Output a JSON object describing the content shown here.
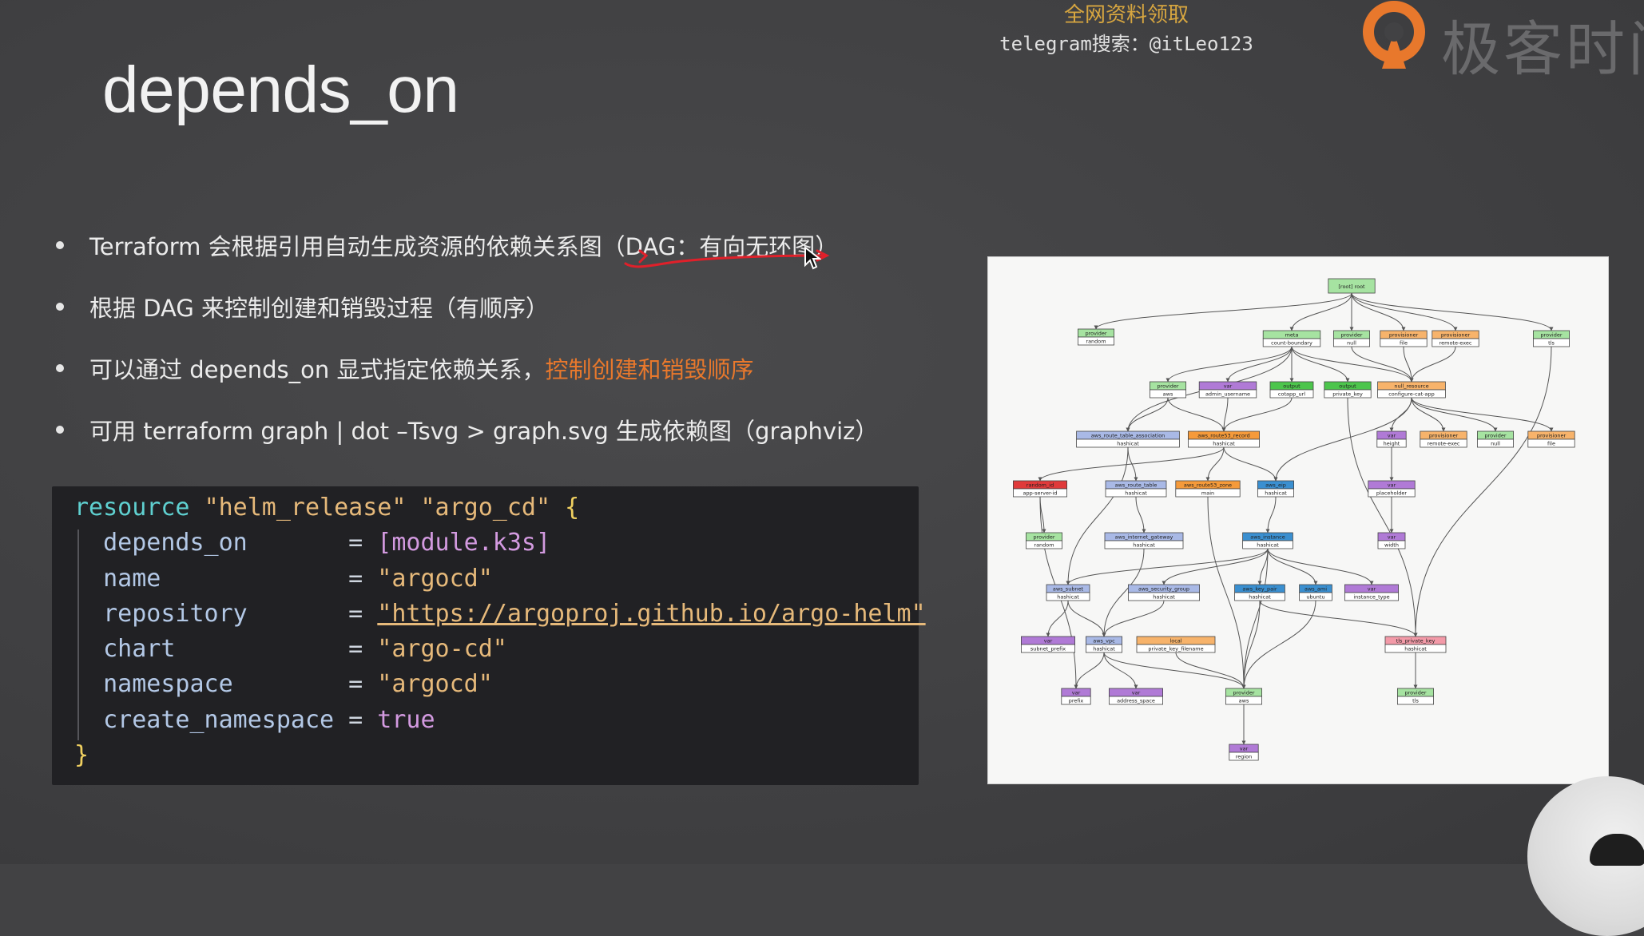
{
  "slide": {
    "title": "depends_on"
  },
  "watermark": {
    "line1": "全网资料领取",
    "line2": "telegram搜索：@itLeo123"
  },
  "brand": {
    "text": "极客时间"
  },
  "bullets": [
    {
      "before": "Terraform 会根据引用自动生成资源的依赖关系图（DAG：有向无环图）",
      "highlight": ""
    },
    {
      "before": "根据 DAG 来控制创建和销毁过程（有顺序）",
      "highlight": ""
    },
    {
      "before": "可以通过 depends_on 显式指定依赖关系，",
      "highlight": "控制创建和销毁顺序"
    },
    {
      "before": "可用 terraform graph | dot –Tsvg > graph.svg 生成依赖图（graphviz）",
      "highlight": ""
    }
  ],
  "code": {
    "resource_kw": "resource",
    "type": "\"helm_release\"",
    "name": "\"argo_cd\"",
    "open": "{",
    "close": "}",
    "eq": "=",
    "attrs": [
      {
        "key": "depends_on      ",
        "value": "[module.k3s]",
        "cls": "num"
      },
      {
        "key": "name            ",
        "value": "\"argocd\"",
        "cls": "str"
      },
      {
        "key": "repository      ",
        "value": "\"https://argoproj.github.io/argo-helm\"",
        "cls": "str"
      },
      {
        "key": "chart           ",
        "value": "\"argo-cd\"",
        "cls": "str"
      },
      {
        "key": "namespace       ",
        "value": "\"argocd\"",
        "cls": "str"
      },
      {
        "key": "create_namespace",
        "value": "true",
        "cls": "num"
      }
    ]
  },
  "graph": {
    "nodes": [
      {
        "id": "root",
        "type": "[root] root",
        "name": "",
        "color": "#a6e3a1"
      },
      {
        "id": "prov_random",
        "type": "provider",
        "name": "random",
        "color": "#a6e3a1"
      },
      {
        "id": "meta",
        "type": "meta",
        "name": "count-boundary",
        "color": "#a6e3a1"
      },
      {
        "id": "prov_null",
        "type": "provider",
        "name": "null",
        "color": "#a6e3a1"
      },
      {
        "id": "prov_file",
        "type": "provisioner",
        "name": "file",
        "color": "#f7b36b"
      },
      {
        "id": "prov_remote",
        "type": "provisioner",
        "name": "remote-exec",
        "color": "#f7b36b"
      },
      {
        "id": "prov_tls",
        "type": "provider",
        "name": "tls",
        "color": "#a6e3a1"
      },
      {
        "id": "prov_aws1",
        "type": "provider",
        "name": "aws",
        "color": "#a6e3a1"
      },
      {
        "id": "var_admin",
        "type": "var",
        "name": "admin_username",
        "color": "#b07ad6"
      },
      {
        "id": "out_cotapp",
        "type": "output",
        "name": "cotapp_url",
        "color": "#4cc54c"
      },
      {
        "id": "out_pk",
        "type": "output",
        "name": "private_key",
        "color": "#4cc54c"
      },
      {
        "id": "null_res",
        "type": "null_resource",
        "name": "configure-cat-app",
        "color": "#f7b36b"
      },
      {
        "id": "rta",
        "type": "aws_route_table_association",
        "name": "hashicat",
        "color": "#a9b9e6"
      },
      {
        "id": "r53rec",
        "type": "aws_route53_record",
        "name": "hashicat",
        "color": "#f59a3a"
      },
      {
        "id": "var_height",
        "type": "var",
        "name": "height",
        "color": "#b07ad6"
      },
      {
        "id": "prov2_remote",
        "type": "provisioner",
        "name": "remote-exec",
        "color": "#f7b36b"
      },
      {
        "id": "prov2_null",
        "type": "provider",
        "name": "null",
        "color": "#a6e3a1"
      },
      {
        "id": "prov2_file",
        "type": "provisioner",
        "name": "file",
        "color": "#f7b36b"
      },
      {
        "id": "rand_id",
        "type": "random_id",
        "name": "app-server-id",
        "color": "#e03a3a"
      },
      {
        "id": "route_table",
        "type": "aws_route_table",
        "name": "hashicat",
        "color": "#a9b9e6"
      },
      {
        "id": "r53zone",
        "type": "aws_route53_zone",
        "name": "main",
        "color": "#f59a3a"
      },
      {
        "id": "eip",
        "type": "aws_eip",
        "name": "hashicat",
        "color": "#3a8fd0"
      },
      {
        "id": "var_placeholder",
        "type": "var",
        "name": "placeholder",
        "color": "#b07ad6"
      },
      {
        "id": "prov_random2",
        "type": "provider",
        "name": "random",
        "color": "#a6e3a1"
      },
      {
        "id": "igw",
        "type": "aws_internet_gateway",
        "name": "hashicat",
        "color": "#a9b9e6"
      },
      {
        "id": "instance",
        "type": "aws_instance",
        "name": "hashicat",
        "color": "#3a8fd0"
      },
      {
        "id": "var_width",
        "type": "var",
        "name": "width",
        "color": "#b07ad6"
      },
      {
        "id": "subnet",
        "type": "aws_subnet",
        "name": "hashicat",
        "color": "#a9b9e6"
      },
      {
        "id": "sg",
        "type": "aws_security_group",
        "name": "hashicat",
        "color": "#a9b9e6"
      },
      {
        "id": "keypair",
        "type": "aws_key_pair",
        "name": "hashicat",
        "color": "#3a8fd0"
      },
      {
        "id": "ami",
        "type": "aws_ami",
        "name": "ubuntu",
        "color": "#3a8fd0"
      },
      {
        "id": "var_itype",
        "type": "var",
        "name": "instance_type",
        "color": "#b07ad6"
      },
      {
        "id": "var_subnet_prefix",
        "type": "var",
        "name": "subnet_prefix",
        "color": "#b07ad6"
      },
      {
        "id": "vpc",
        "type": "aws_vpc",
        "name": "hashicat",
        "color": "#a9b9e6"
      },
      {
        "id": "local_pk",
        "type": "local",
        "name": "private_key_filename",
        "color": "#f7b36b"
      },
      {
        "id": "tls_pk",
        "type": "tls_private_key",
        "name": "hashicat",
        "color": "#f39aa8"
      },
      {
        "id": "var_prefix",
        "type": "var",
        "name": "prefix",
        "color": "#b07ad6"
      },
      {
        "id": "var_addr",
        "type": "var",
        "name": "address_space",
        "color": "#b07ad6"
      },
      {
        "id": "prov_aws",
        "type": "provider",
        "name": "aws",
        "color": "#a6e3a1"
      },
      {
        "id": "prov_tls2",
        "type": "provider",
        "name": "tls",
        "color": "#a6e3a1"
      },
      {
        "id": "var_region",
        "type": "var",
        "name": "region",
        "color": "#b07ad6"
      }
    ],
    "edges": [
      [
        "root",
        "prov_random"
      ],
      [
        "root",
        "meta"
      ],
      [
        "root",
        "prov_null"
      ],
      [
        "root",
        "prov_file"
      ],
      [
        "root",
        "prov_remote"
      ],
      [
        "root",
        "prov_tls"
      ],
      [
        "meta",
        "prov_aws1"
      ],
      [
        "meta",
        "var_admin"
      ],
      [
        "meta",
        "out_cotapp"
      ],
      [
        "meta",
        "out_pk"
      ],
      [
        "meta",
        "null_res"
      ],
      [
        "meta",
        "rta"
      ],
      [
        "prov_null",
        "null_res"
      ],
      [
        "prov_file",
        "null_res"
      ],
      [
        "prov_remote",
        "null_res"
      ],
      [
        "prov_aws1",
        "rta"
      ],
      [
        "prov_aws1",
        "r53rec"
      ],
      [
        "var_admin",
        "r53rec"
      ],
      [
        "out_cotapp",
        "r53rec"
      ],
      [
        "out_pk",
        "tls_pk"
      ],
      [
        "null_res",
        "var_height"
      ],
      [
        "null_res",
        "prov2_remote"
      ],
      [
        "null_res",
        "prov2_null"
      ],
      [
        "null_res",
        "prov2_file"
      ],
      [
        "null_res",
        "eip"
      ],
      [
        "rta",
        "route_table"
      ],
      [
        "rta",
        "subnet"
      ],
      [
        "r53rec",
        "rand_id"
      ],
      [
        "r53rec",
        "r53zone"
      ],
      [
        "r53rec",
        "eip"
      ],
      [
        "var_height",
        "var_placeholder"
      ],
      [
        "var_placeholder",
        "var_width"
      ],
      [
        "rand_id",
        "prov_random2"
      ],
      [
        "rand_id",
        "var_prefix"
      ],
      [
        "route_table",
        "igw"
      ],
      [
        "r53zone",
        "prov_aws"
      ],
      [
        "eip",
        "instance"
      ],
      [
        "igw",
        "vpc"
      ],
      [
        "instance",
        "subnet"
      ],
      [
        "instance",
        "sg"
      ],
      [
        "instance",
        "keypair"
      ],
      [
        "instance",
        "ami"
      ],
      [
        "instance",
        "var_itype"
      ],
      [
        "instance",
        "prov_aws"
      ],
      [
        "subnet",
        "var_subnet_prefix"
      ],
      [
        "subnet",
        "vpc"
      ],
      [
        "sg",
        "vpc"
      ],
      [
        "keypair",
        "tls_pk"
      ],
      [
        "keypair",
        "prov_aws"
      ],
      [
        "ami",
        "prov_aws"
      ],
      [
        "vpc",
        "var_prefix"
      ],
      [
        "vpc",
        "var_addr"
      ],
      [
        "vpc",
        "prov_aws"
      ],
      [
        "local_pk",
        "prov_aws"
      ],
      [
        "tls_pk",
        "prov_tls2"
      ],
      [
        "prov_aws",
        "var_region"
      ],
      [
        "prov_tls",
        "tls_pk"
      ]
    ]
  }
}
